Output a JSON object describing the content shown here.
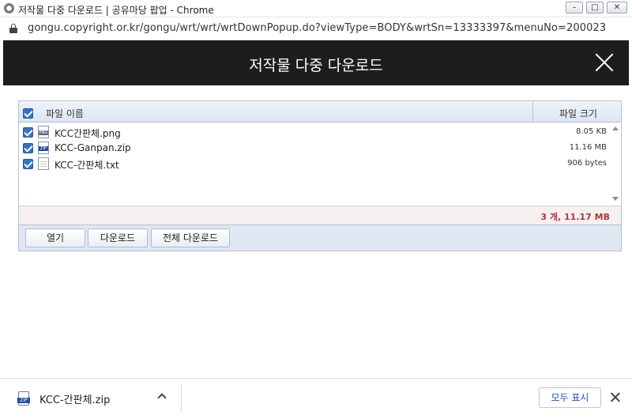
{
  "window": {
    "title": "저작물 다중 다운로드 | 공유마당 팝업 - Chrome",
    "minimize_icon": "minimize-icon",
    "maximize_icon": "maximize-icon",
    "close_icon": "close-icon"
  },
  "address_bar": {
    "url": "gongu.copyright.or.kr/gongu/wrt/wrt/wrtDownPopup.do?viewType=BODY&wrtSn=13333397&menuNo=200023"
  },
  "popup": {
    "title": "저작물 다중 다운로드"
  },
  "file_list": {
    "header": {
      "select_all_checked": true,
      "col_name": "파일 이름",
      "col_size": "파일 크기"
    },
    "rows": [
      {
        "checked": true,
        "icon": "png-file-icon",
        "name": "KCC간판체.png",
        "size": "8.05 KB"
      },
      {
        "checked": true,
        "icon": "zip-file-icon",
        "name": "KCC-Ganpan.zip",
        "size": "11.16 MB"
      },
      {
        "checked": true,
        "icon": "txt-file-icon",
        "name": "KCC-간판체.txt",
        "size": "906 bytes"
      }
    ],
    "summary": "3 개, 11.17 MB"
  },
  "buttons": {
    "open": "열기",
    "download": "다운로드",
    "download_all": "전체 다운로드"
  },
  "download_shelf": {
    "file_name": "KCC-간판체.zip",
    "show_all": "모두 표시"
  },
  "colors": {
    "header_bg": "#1d1d1d",
    "accent_blue": "#2f74c8",
    "summary_text": "#b0353a",
    "link_blue": "#1a56c2"
  }
}
